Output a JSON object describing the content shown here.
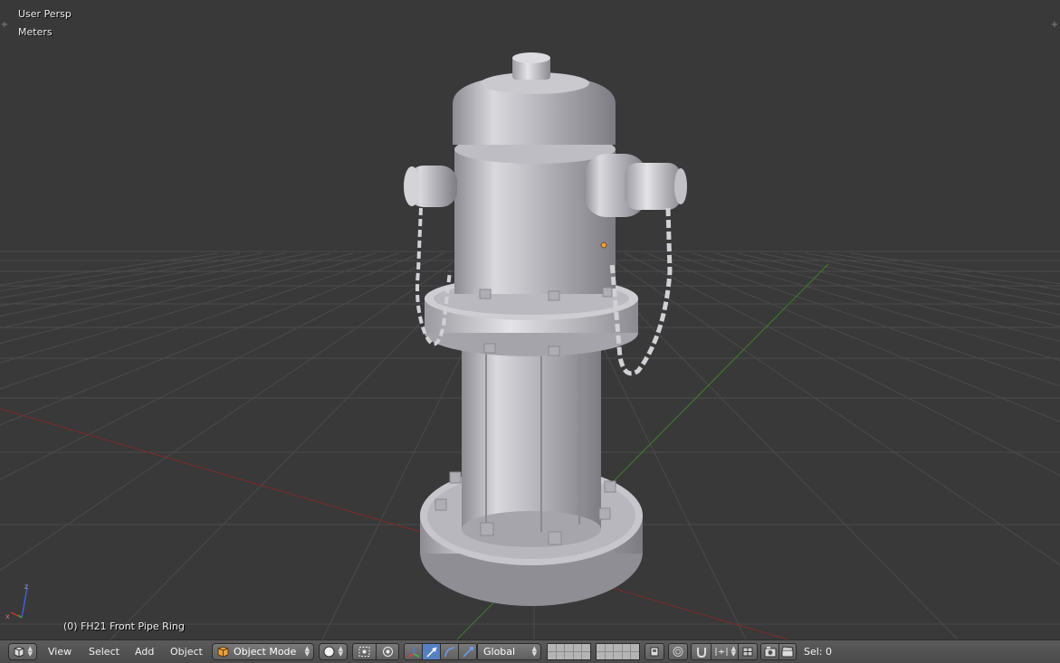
{
  "viewport": {
    "view_name": "User Persp",
    "units": "Meters",
    "active_object": "(0) FH21 Front Pipe Ring"
  },
  "header": {
    "editor_type_icon": "3d-view-icon",
    "menus": [
      "View",
      "Select",
      "Add",
      "Object"
    ],
    "mode": "Object Mode",
    "mode_icon": "object-cube-icon",
    "shading_icon": "solid-sphere-icon",
    "pivot_icon": "pivot-bounding-box-icon",
    "manipulator_icons": [
      "manipulator-toggle-icon",
      "translate-icon",
      "rotate-icon",
      "scale-icon"
    ],
    "orientation": "Global",
    "lock_layers_icon": "lock-layers-icon",
    "proportional_icon": "proportional-edit-icon",
    "snap_icon": "snap-magnet-icon",
    "snap_element_icon": "snap-increment-icon",
    "render_icon": "render-camera-icon",
    "anim_render_icon": "clapperboard-icon",
    "selection_count": "Sel: 0"
  },
  "colors": {
    "viewport_bg": "#393939",
    "grid": "#4a4a4a",
    "x_axis": "#8a2a2a",
    "y_axis": "#3f8a2a",
    "header_bg": "#4f4f4f",
    "active_button": "#5680c2"
  }
}
